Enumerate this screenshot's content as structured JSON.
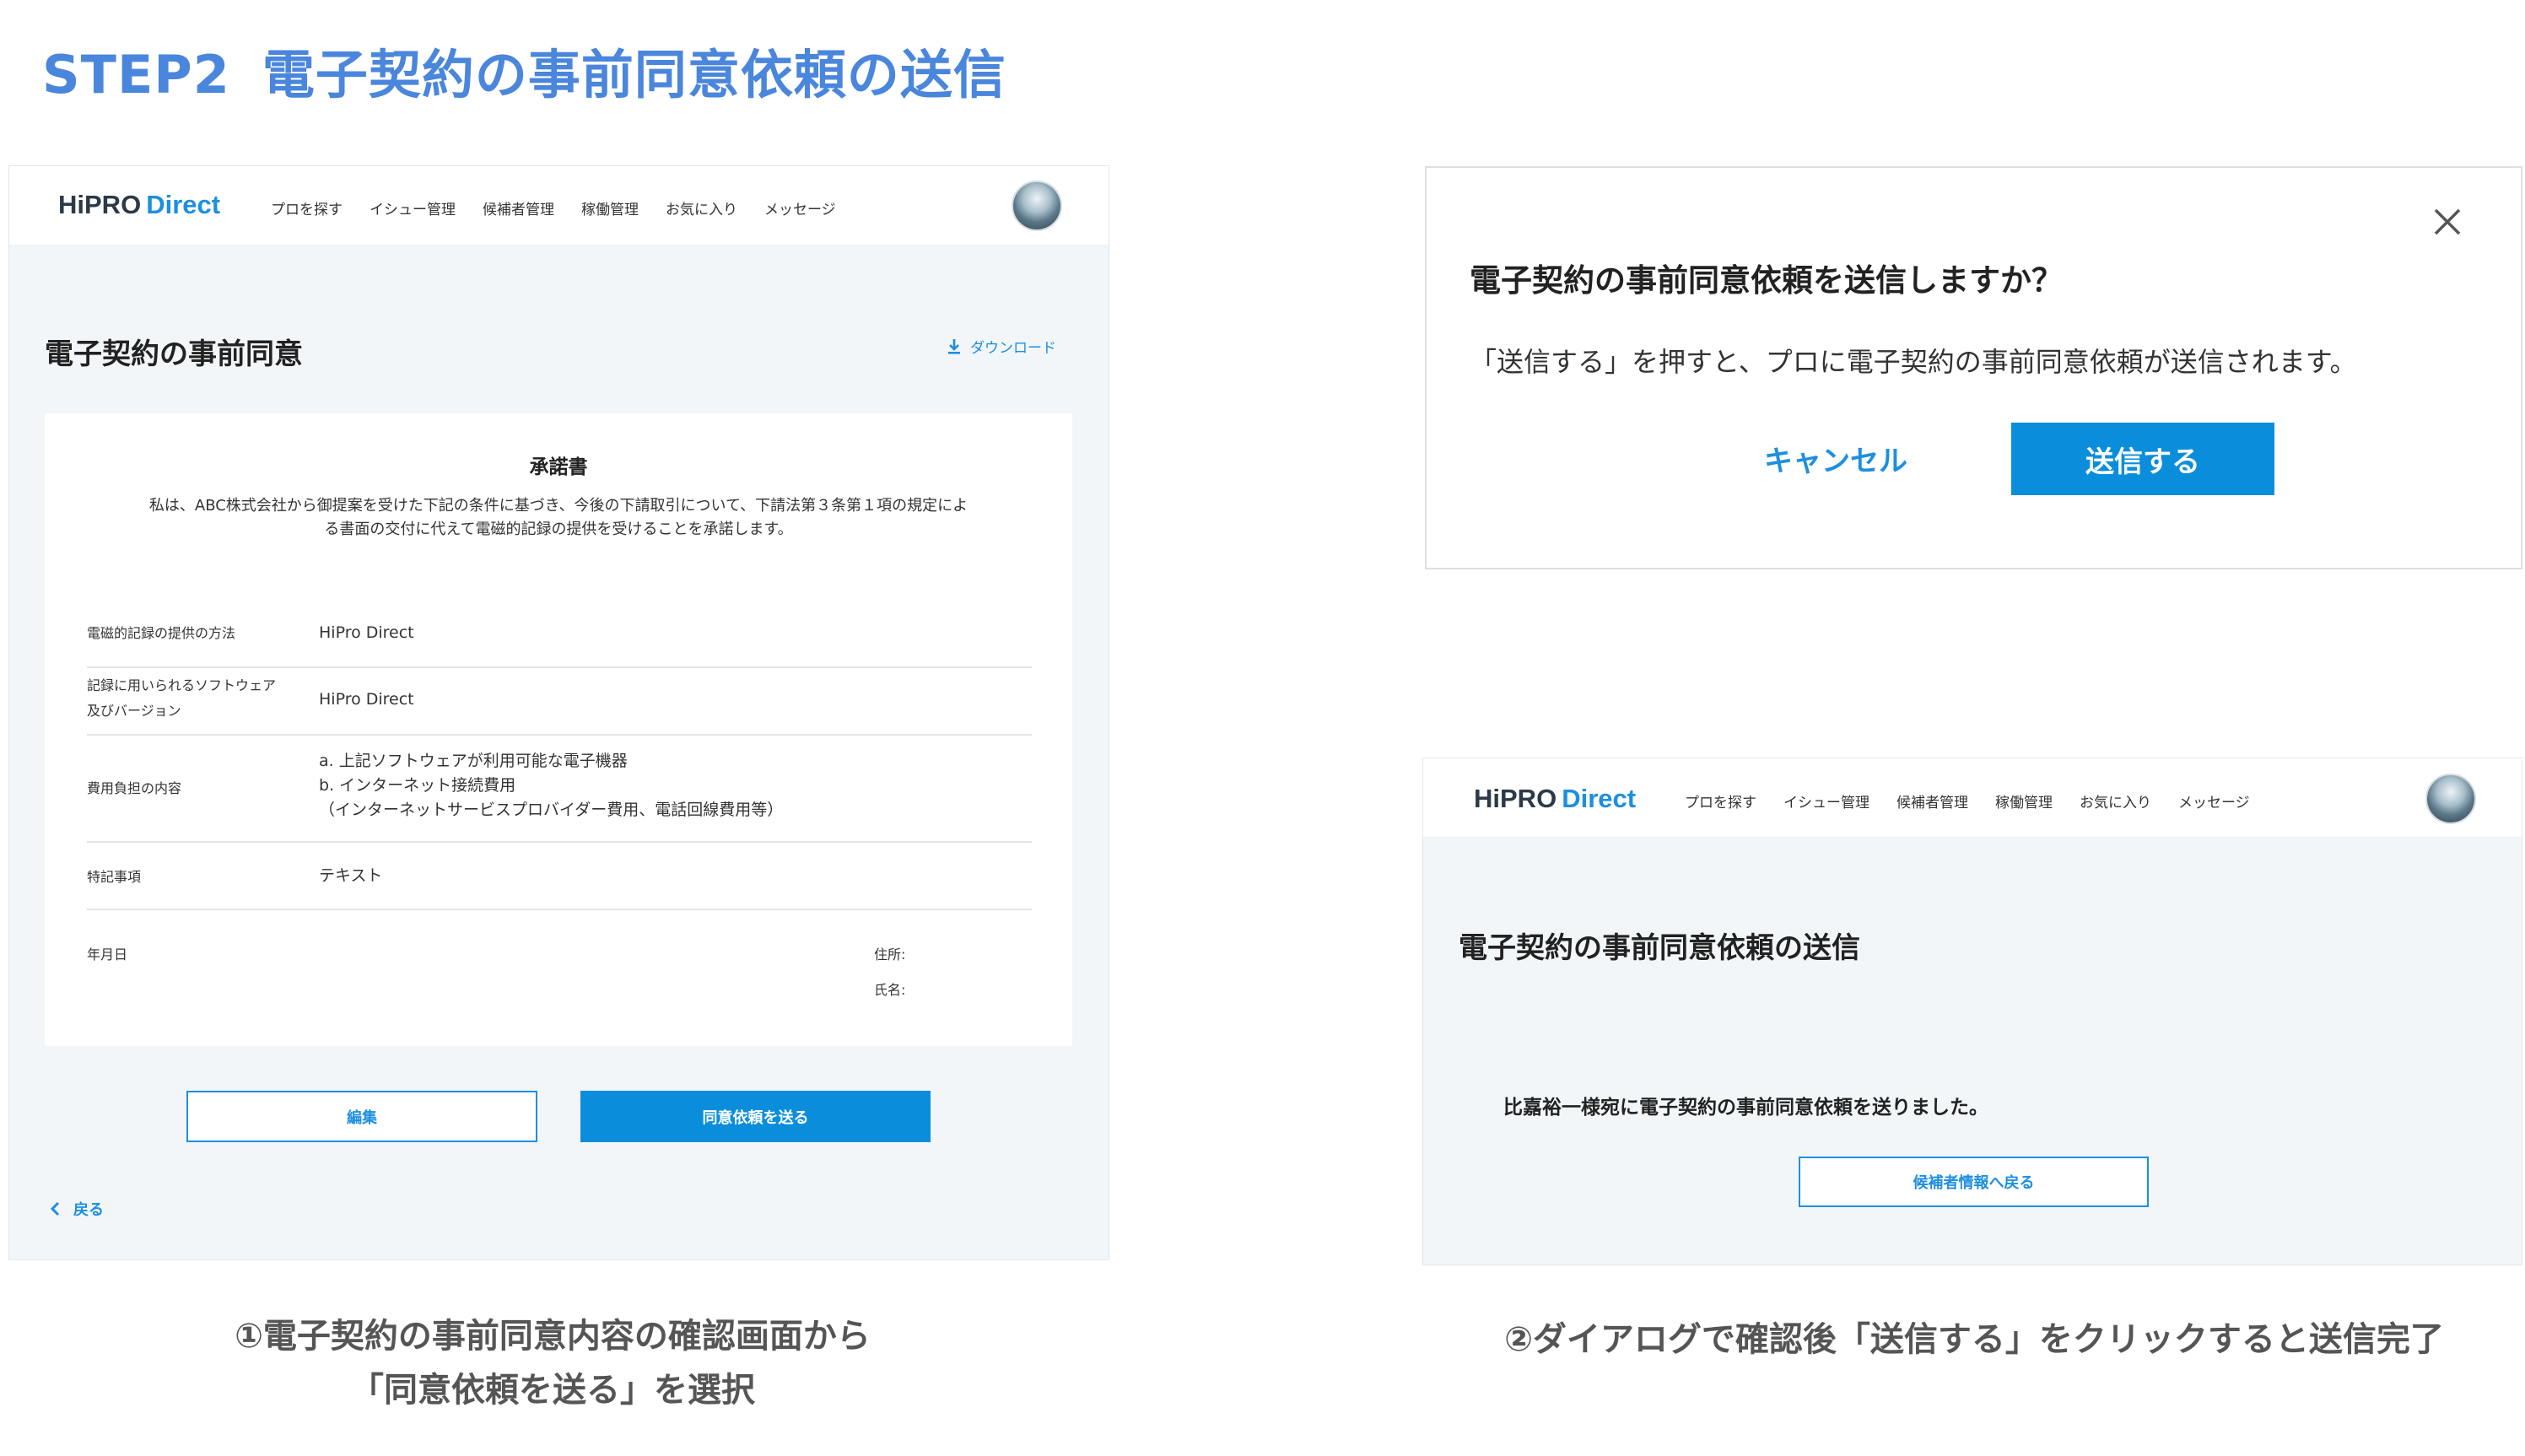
{
  "header": {
    "step": "STEP2",
    "title": "電子契約の事前同意依頼の送信"
  },
  "brand": {
    "logo_dark": "HiPRO",
    "logo_blue": "Direct",
    "accent_color": "#0a8edc",
    "title_color": "#4a86dc"
  },
  "nav": {
    "items": [
      "プロを探す",
      "イシュー管理",
      "候補者管理",
      "稼働管理",
      "お気に入り",
      "メッセージ"
    ]
  },
  "consent_screen": {
    "heading": "電子契約の事前同意",
    "download": "ダウンロード",
    "document": {
      "title": "承諾書",
      "intro_line1": "私は、ABC株式会社から御提案を受けた下記の条件に基づき、今後の下請取引について、下請法第３条第１項の規定によ",
      "intro_line2": "る書面の交付に代えて電磁的記録の提供を受けることを承諾します。",
      "rows": [
        {
          "label": "電磁的記録の提供の方法",
          "value": "HiPro Direct"
        },
        {
          "label_line1": "記録に用いられるソフトウェア",
          "label_line2": "及びバージョン",
          "value": "HiPro Direct"
        },
        {
          "label": "費用負担の内容",
          "value_line1": "a. 上記ソフトウェアが利用可能な電子機器",
          "value_line2": "b. インターネット接続費用",
          "value_line3": "（インターネットサービスプロバイダー費用、電話回線費用等）"
        },
        {
          "label": "特記事項",
          "value": "テキスト"
        }
      ],
      "date_label": "年月日",
      "address_label": "住所:",
      "name_label": "氏名:"
    },
    "edit_button": "編集",
    "send_request_button": "同意依頼を送る",
    "back_link": "戻る"
  },
  "dialog": {
    "title": "電子契約の事前同意依頼を送信しますか？",
    "message": "「送信する」を押すと、プロに電子契約の事前同意依頼が送信されます。",
    "cancel_button": "キャンセル",
    "send_button": "送信する"
  },
  "complete_screen": {
    "heading": "電子契約の事前同意依頼の送信",
    "message": "比嘉裕一様宛に電子契約の事前同意依頼を送りました。",
    "back_button": "候補者情報へ戻る"
  },
  "captions": {
    "left_line1": "①電子契約の事前同意内容の確認画面から",
    "left_line2": "「同意依頼を送る」を選択",
    "right": "②ダイアログで確認後「送信する」をクリックすると送信完了"
  }
}
